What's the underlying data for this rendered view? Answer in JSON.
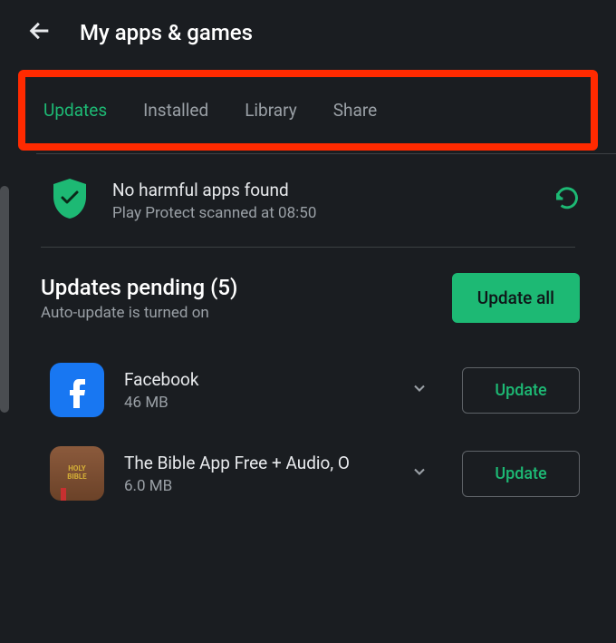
{
  "header": {
    "title": "My apps & games"
  },
  "tabs": [
    {
      "label": "Updates",
      "active": true
    },
    {
      "label": "Installed",
      "active": false
    },
    {
      "label": "Library",
      "active": false
    },
    {
      "label": "Share",
      "active": false
    }
  ],
  "protect": {
    "title": "No harmful apps found",
    "subtitle": "Play Protect scanned at 08:50"
  },
  "updates": {
    "title": "Updates pending (5)",
    "subtitle": "Auto-update is turned on",
    "update_all_label": "Update all",
    "update_label": "Update"
  },
  "apps": [
    {
      "name": "Facebook",
      "size": "46 MB",
      "icon": "facebook"
    },
    {
      "name": "The Bible App Free + Audio, O",
      "size": "6.0 MB",
      "icon": "bible"
    }
  ],
  "icons": {
    "bible_line1": "HOLY",
    "bible_line2": "BIBLE"
  }
}
